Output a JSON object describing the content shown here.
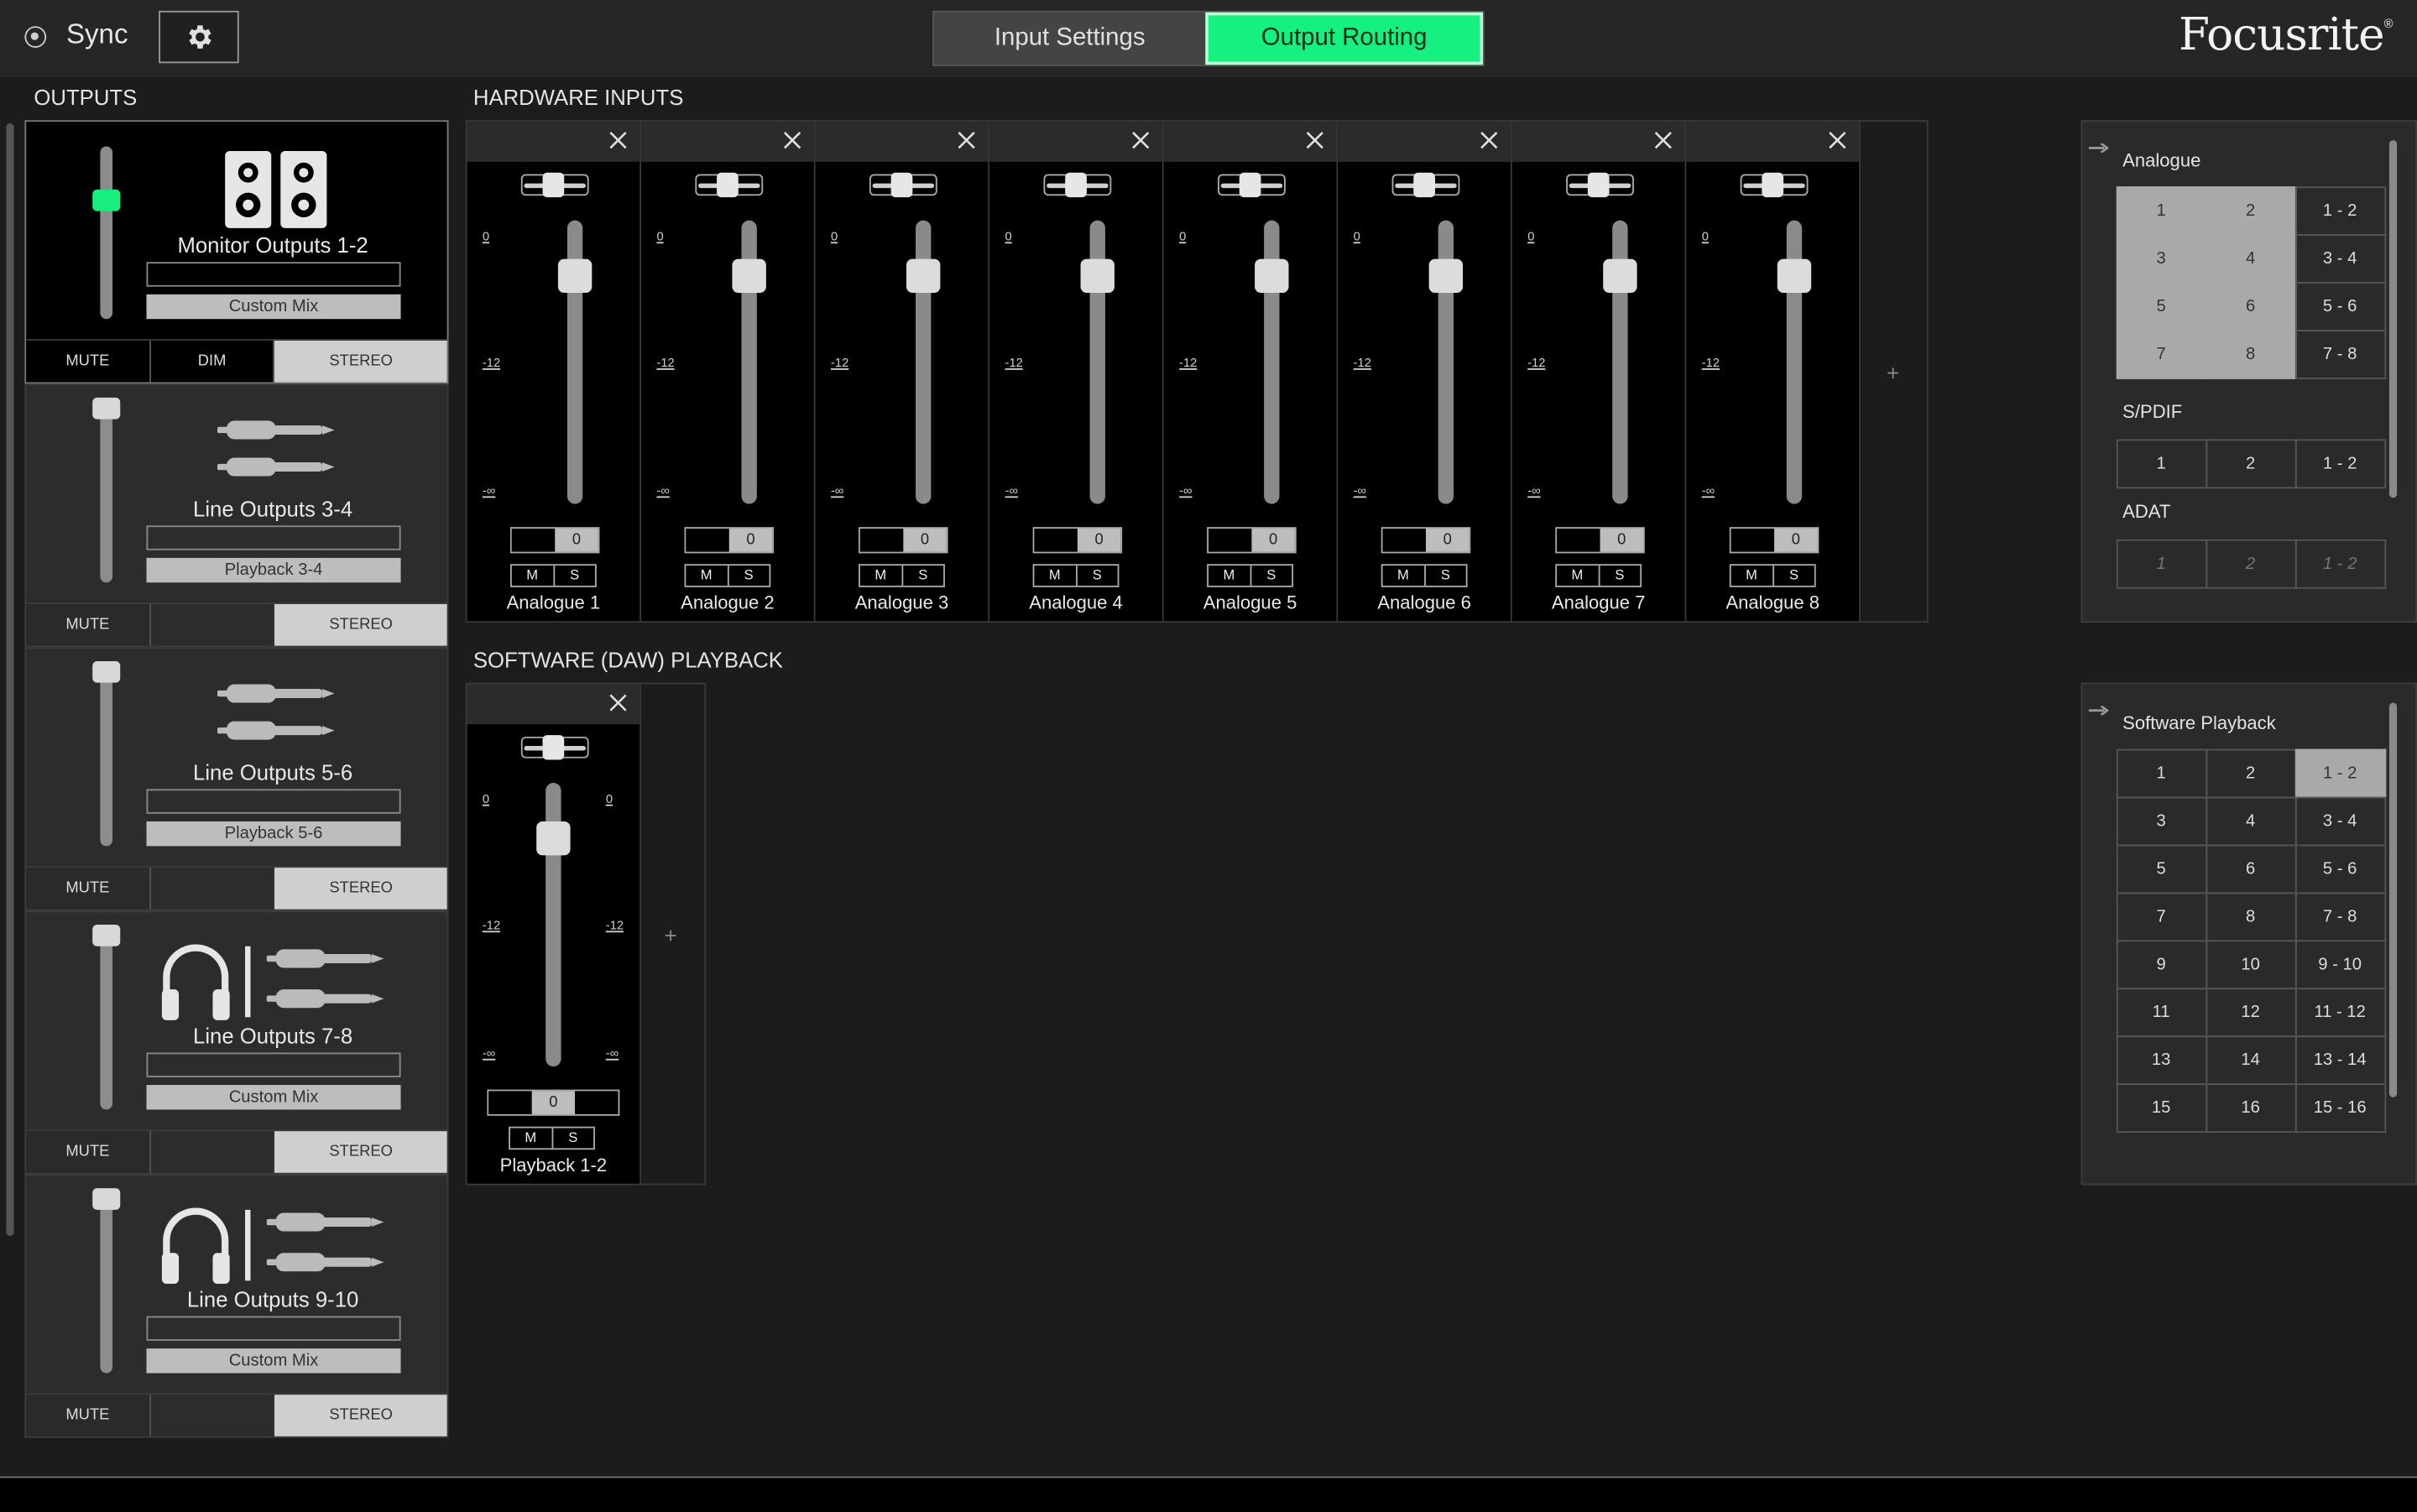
{
  "topbar": {
    "sync_label": "Sync",
    "tabs": [
      {
        "label": "Input Settings",
        "active": false
      },
      {
        "label": "Output Routing",
        "active": true
      }
    ],
    "logo": "Focusrite",
    "logo_mark": "®",
    "accent_color": "#16f080"
  },
  "outputs": {
    "title": "OUTPUTS",
    "items": [
      {
        "name": "Monitor Outputs 1-2",
        "source": "Custom Mix",
        "mute": "MUTE",
        "dim": "DIM",
        "stereo": "STEREO",
        "icon": "speakers-icon",
        "selected": true
      },
      {
        "name": "Line Outputs 3-4",
        "source": "Playback 3-4",
        "mute": "MUTE",
        "stereo": "STEREO",
        "icon": "line-cables-icon"
      },
      {
        "name": "Line Outputs 5-6",
        "source": "Playback 5-6",
        "mute": "MUTE",
        "stereo": "STEREO",
        "icon": "line-cables-icon"
      },
      {
        "name": "Line Outputs 7-8",
        "source": "Custom Mix",
        "mute": "MUTE",
        "stereo": "STEREO",
        "icon": "headphones-cables-icon"
      },
      {
        "name": "Line Outputs 9-10",
        "source": "Custom Mix",
        "mute": "MUTE",
        "stereo": "STEREO",
        "icon": "headphones-cables-icon"
      }
    ]
  },
  "hardware_inputs": {
    "title": "HARDWARE INPUTS",
    "scale": {
      "top": "0",
      "mid": "-12",
      "bottom": "-∞"
    },
    "mute_label": "M",
    "solo_label": "S",
    "add_symbol": "+",
    "strips": [
      {
        "name": "Analogue 1",
        "gain": "0"
      },
      {
        "name": "Analogue 2",
        "gain": "0"
      },
      {
        "name": "Analogue 3",
        "gain": "0"
      },
      {
        "name": "Analogue 4",
        "gain": "0"
      },
      {
        "name": "Analogue 5",
        "gain": "0"
      },
      {
        "name": "Analogue 6",
        "gain": "0"
      },
      {
        "name": "Analogue 7",
        "gain": "0"
      },
      {
        "name": "Analogue 8",
        "gain": "0"
      }
    ]
  },
  "daw_playback": {
    "title": "SOFTWARE (DAW) PLAYBACK",
    "scale": {
      "top": "0",
      "mid": "-12",
      "bottom": "-∞"
    },
    "mute_label": "M",
    "solo_label": "S",
    "add_symbol": "+",
    "strip": {
      "name": "Playback 1-2",
      "gain": "0"
    }
  },
  "routing": {
    "hardware": {
      "sections": [
        {
          "title": "Analogue",
          "cells": [
            {
              "label": "1",
              "on": true
            },
            {
              "label": "2",
              "on": true
            },
            {
              "label": "1 - 2",
              "on": false
            },
            {
              "label": "3",
              "on": true
            },
            {
              "label": "4",
              "on": true
            },
            {
              "label": "3 - 4",
              "on": false
            },
            {
              "label": "5",
              "on": true
            },
            {
              "label": "6",
              "on": true
            },
            {
              "label": "5 - 6",
              "on": false
            },
            {
              "label": "7",
              "on": true
            },
            {
              "label": "8",
              "on": true
            },
            {
              "label": "7 - 8",
              "on": false
            }
          ]
        },
        {
          "title": "S/PDIF",
          "cells": [
            {
              "label": "1",
              "on": false
            },
            {
              "label": "2",
              "on": false
            },
            {
              "label": "1 - 2",
              "on": false
            }
          ]
        },
        {
          "title": "ADAT",
          "cells": [
            {
              "label": "1",
              "on": false,
              "disabled": true
            },
            {
              "label": "2",
              "on": false,
              "disabled": true
            },
            {
              "label": "1 - 2",
              "on": false,
              "disabled": true
            }
          ]
        }
      ]
    },
    "software": {
      "title": "Software Playback",
      "cells": [
        {
          "label": "1"
        },
        {
          "label": "2"
        },
        {
          "label": "1 - 2",
          "on": true
        },
        {
          "label": "3"
        },
        {
          "label": "4"
        },
        {
          "label": "3 - 4"
        },
        {
          "label": "5"
        },
        {
          "label": "6"
        },
        {
          "label": "5 - 6"
        },
        {
          "label": "7"
        },
        {
          "label": "8"
        },
        {
          "label": "7 - 8"
        },
        {
          "label": "9"
        },
        {
          "label": "10"
        },
        {
          "label": "9 - 10"
        },
        {
          "label": "11"
        },
        {
          "label": "12"
        },
        {
          "label": "11 - 12"
        },
        {
          "label": "13"
        },
        {
          "label": "14"
        },
        {
          "label": "13 - 14"
        },
        {
          "label": "15"
        },
        {
          "label": "16"
        },
        {
          "label": "15 - 16"
        }
      ]
    }
  }
}
